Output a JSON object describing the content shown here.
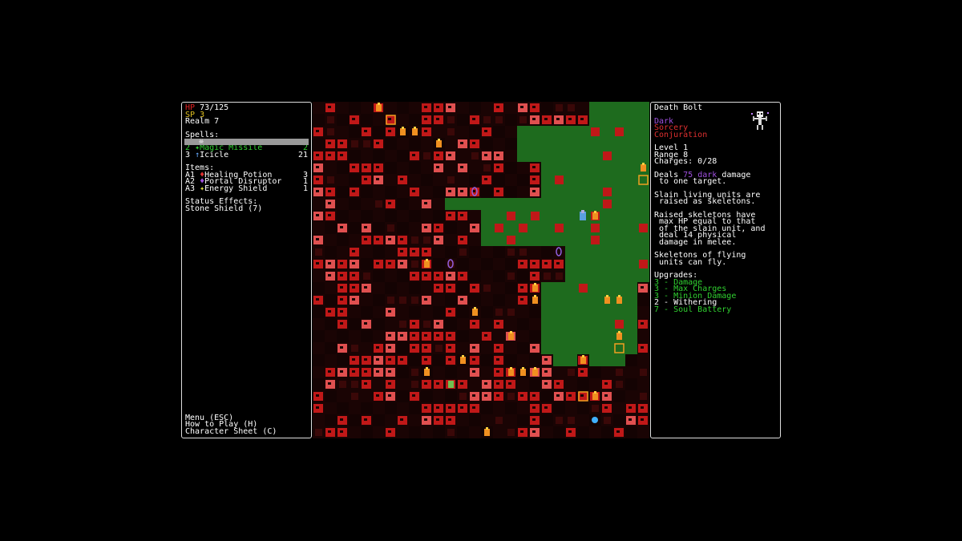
{
  "colors": {
    "hp": "#e02020",
    "sp": "#e0c020",
    "selected_spell": "#30d030",
    "dark": "#a050e0",
    "sorcery": "#e03030",
    "conjuration": "#e03030",
    "upgrade_green": "#30d030",
    "map_red": "#c01818",
    "map_green": "#1e6b1e"
  },
  "left": {
    "hp_label": "HP",
    "hp_value": "73/125",
    "sp_label": "SP",
    "sp_value": "3",
    "realm": "Realm 7",
    "spells_header": "Spells:",
    "spells": [
      {
        "key": "1",
        "icon": "death-bolt-icon",
        "name": "",
        "charges": "",
        "highlighted": true
      },
      {
        "key": "2",
        "icon": "magic-missile-icon",
        "name": "Magic Missile",
        "charges": "2",
        "selected": true
      },
      {
        "key": "3",
        "icon": "icicle-icon",
        "name": "Icicle",
        "charges": "21"
      }
    ],
    "items_header": "Items:",
    "items": [
      {
        "key": "A1",
        "icon": "healing-potion-icon",
        "name": "Healing Potion",
        "count": "3"
      },
      {
        "key": "A2",
        "icon": "portal-disruptor-icon",
        "name": "Portal Disruptor",
        "count": "1"
      },
      {
        "key": "A3",
        "icon": "energy-shield-icon",
        "name": "Energy Shield",
        "count": "1"
      }
    ],
    "status_header": "Status Effects:",
    "status_effects": [
      "Stone Shield (7)"
    ],
    "menu": [
      "Menu (ESC)",
      "How to Play (H)",
      "Character Sheet (C)"
    ]
  },
  "right": {
    "spell_name": "Death Bolt",
    "portrait_icon": "skeleton-icon",
    "tags": [
      "Dark",
      "Sorcery",
      "Conjuration"
    ],
    "level": "Level 1",
    "range": "Range 8",
    "charges": "Charges: 0/28",
    "desc1_pre": "Deals ",
    "desc1_num": "75",
    "desc1_type": "dark",
    "desc1_post": " damage",
    "desc1_line2": " to one target.",
    "desc2_l1": "Slain living units are",
    "desc2_l2": " raised as skeletons.",
    "desc3_l1": "Raised skeletons have",
    "desc3_l2": " max HP equal to that",
    "desc3_l3": " of the slain unit, and",
    "desc3_l4": " deal 14 physical",
    "desc3_l5": " damage in melee.",
    "desc4_l1": "Skeletons of flying",
    "desc4_l2": " units can fly.",
    "upgrades_header": "Upgrades:",
    "upgrades": [
      {
        "text": "3 - Damage",
        "color": "#30d030"
      },
      {
        "text": "3 - Max Charges",
        "color": "#30d030"
      },
      {
        "text": "3 - Minion Damage",
        "color": "#30d030"
      },
      {
        "text": "2 - Withering",
        "color": "#ffffff"
      },
      {
        "text": "7 - Soul Battery",
        "color": "#30d030"
      }
    ]
  }
}
